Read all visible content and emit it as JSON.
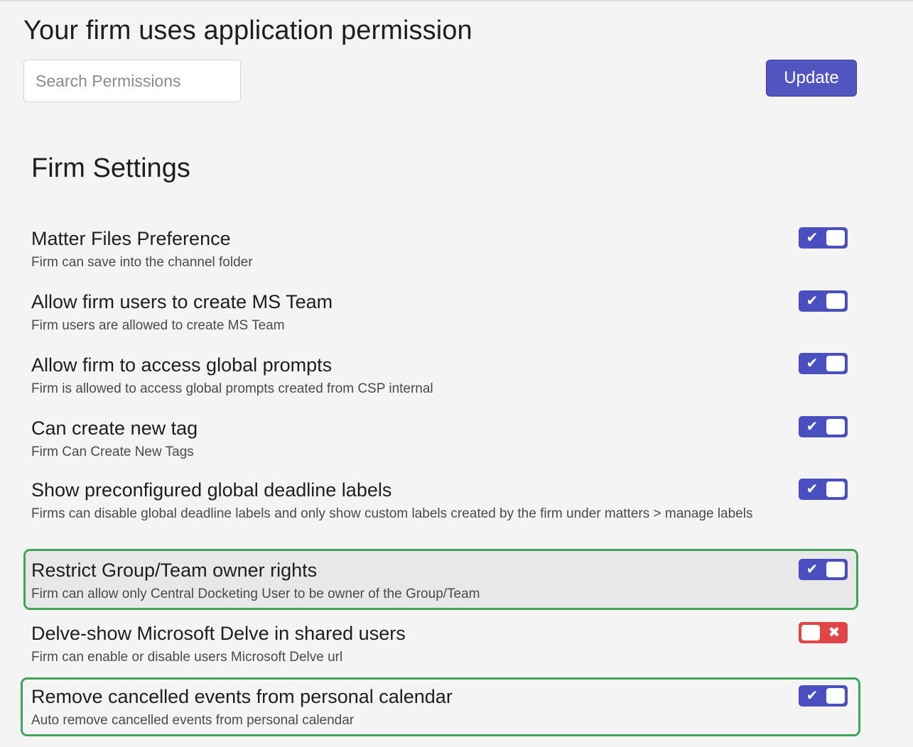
{
  "header": {
    "title": "Your firm uses application permission",
    "search_placeholder": "Search Permissions",
    "update_label": "Update"
  },
  "section": {
    "title": "Firm Settings"
  },
  "settings": [
    {
      "title": "Matter Files Preference",
      "description": "Firm can save into the channel folder",
      "enabled": true,
      "toggle_glyph": "✔"
    },
    {
      "title": "Allow firm users to create MS Team",
      "description": "Firm users are allowed to create MS Team",
      "enabled": true,
      "toggle_glyph": "✔"
    },
    {
      "title": "Allow firm to access global prompts",
      "description": "Firm is allowed to access global prompts created from CSP internal",
      "enabled": true,
      "toggle_glyph": "✔"
    },
    {
      "title": "Can create new tag",
      "description": "Firm Can Create New Tags",
      "enabled": true,
      "toggle_glyph": "✔"
    },
    {
      "title": "Show preconfigured global deadline labels",
      "description": "Firms can disable global deadline labels and only show custom labels created by the firm under matters > manage labels",
      "enabled": true,
      "toggle_glyph": "✔"
    },
    {
      "title": "Restrict Group/Team owner rights",
      "description": "Firm can allow only Central Docketing User to be owner of the Group/Team",
      "enabled": true,
      "toggle_glyph": "✔",
      "highlighted": true
    },
    {
      "title": "Delve-show Microsoft Delve in shared users",
      "description": "Firm can enable or disable users Microsoft Delve url",
      "enabled": false,
      "toggle_glyph": "✖"
    },
    {
      "title": "Remove cancelled events from personal calendar",
      "description": "Auto remove cancelled events from personal calendar",
      "enabled": true,
      "toggle_glyph": "✔",
      "highlighted": true
    }
  ],
  "colors": {
    "accent": "#4a4fc0",
    "toggle_off": "#e24545",
    "highlight_border": "#3fa55b",
    "background": "#f4f4f4"
  },
  "icons": {
    "toggle_on": "check-icon",
    "toggle_off": "x-icon"
  }
}
